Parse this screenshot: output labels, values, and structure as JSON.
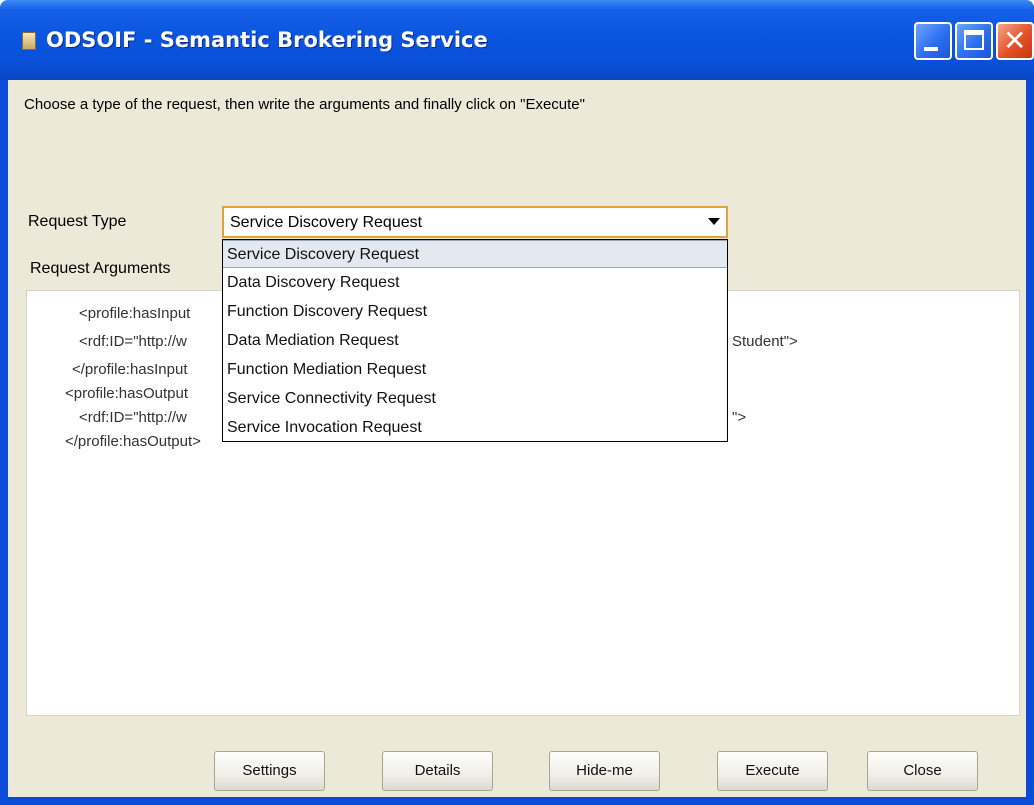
{
  "window": {
    "title": "ODSOIF - Semantic Brokering Service",
    "icon": "app-icon",
    "controls": [
      "minimize-icon",
      "maximize-icon",
      "close-icon"
    ]
  },
  "instruction": "Choose a type of the request, then write the arguments and finally click on \"Execute\"",
  "request_type": {
    "label": "Request Type",
    "selected": "Service Discovery Request",
    "options": [
      "Service Discovery Request",
      "Data Discovery Request",
      "Function Discovery Request",
      "Data Mediation Request",
      "Function Mediation Request",
      "Service Connectivity Request",
      "Service Invocation Request"
    ],
    "highlighted_option": "Service Discovery Request"
  },
  "request_arguments": {
    "label": "Request Arguments",
    "lines": [
      "<profile:hasInput",
      "<rdf:ID=\"http://w",
      "</profile:hasInput",
      "<profile:hasOutput",
      "<rdf:ID=\"http://w",
      "</profile:hasOutput>"
    ],
    "partial_right": [
      "Student\">",
      "\">"
    ]
  },
  "buttons": {
    "settings": "Settings",
    "details": "Details",
    "hide": "Hide-me",
    "execute": "Execute",
    "close": "Close"
  },
  "colors": {
    "titlebar": "#0a55e0",
    "client_background": "#ece9d8",
    "combo_focus_border": "#e3a13a",
    "close_button": "#e3512a"
  }
}
